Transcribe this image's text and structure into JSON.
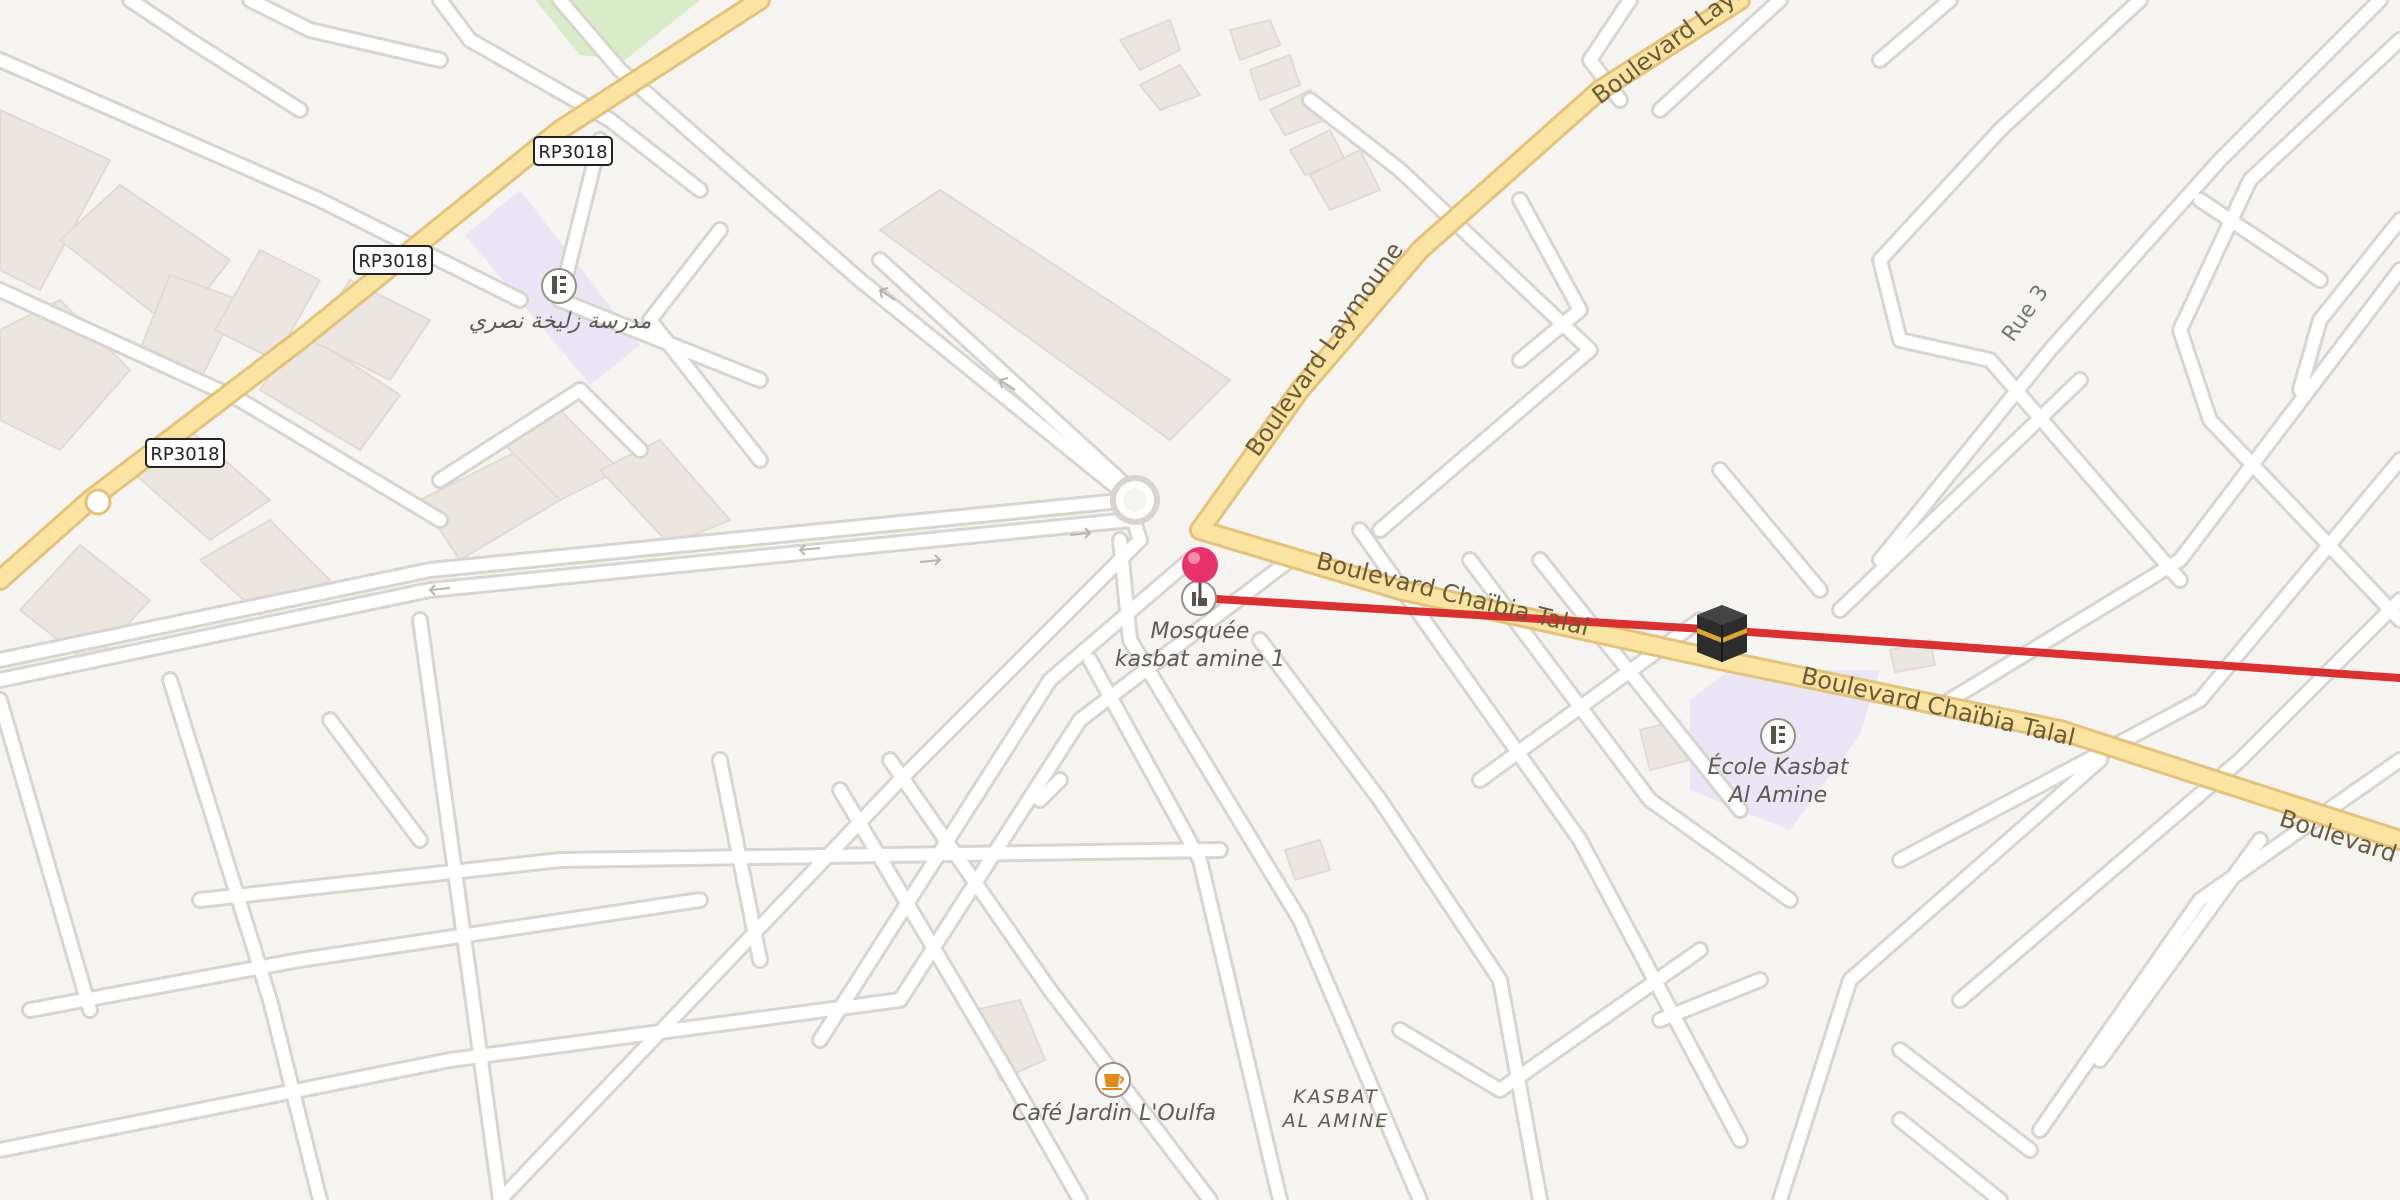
{
  "map": {
    "colors": {
      "background": "#f6f4f1",
      "building": "#ece6e0",
      "school_area": "#ebe6f6",
      "park": "#d9ecc8",
      "primary_road": "#fbe3a1",
      "route_line": "#d93030",
      "pin": "#e8336a"
    },
    "roads": {
      "laymoune": "Boulevard Laymoune",
      "laymoune_top": "Boulevard Laym",
      "chaibia_1": "Boulevard Chaïbia Talal",
      "chaibia_2": "Boulevard Chaïbia Talal",
      "chaibia_right": "Boulevard",
      "rue3": "Rue 3"
    },
    "shields": [
      "RP3018",
      "RP3018",
      "RP3018"
    ],
    "pois": {
      "mosque_line1": "Mosquée",
      "mosque_line2": "kasbat amine 1",
      "madrasa": "مدرسة زليخة نصري",
      "ecole_line1": "École Kasbat",
      "ecole_line2": "Al Amine",
      "cafe": "Café Jardin L'Oulfa"
    },
    "area": {
      "line1": "KASBAT",
      "line2": "AL AMINE"
    },
    "icons": {
      "pin": "map-pin-icon",
      "mosque": "mosque-icon",
      "school": "school-icon",
      "cafe": "coffee-cup-icon",
      "kaaba": "kaaba-icon"
    }
  }
}
